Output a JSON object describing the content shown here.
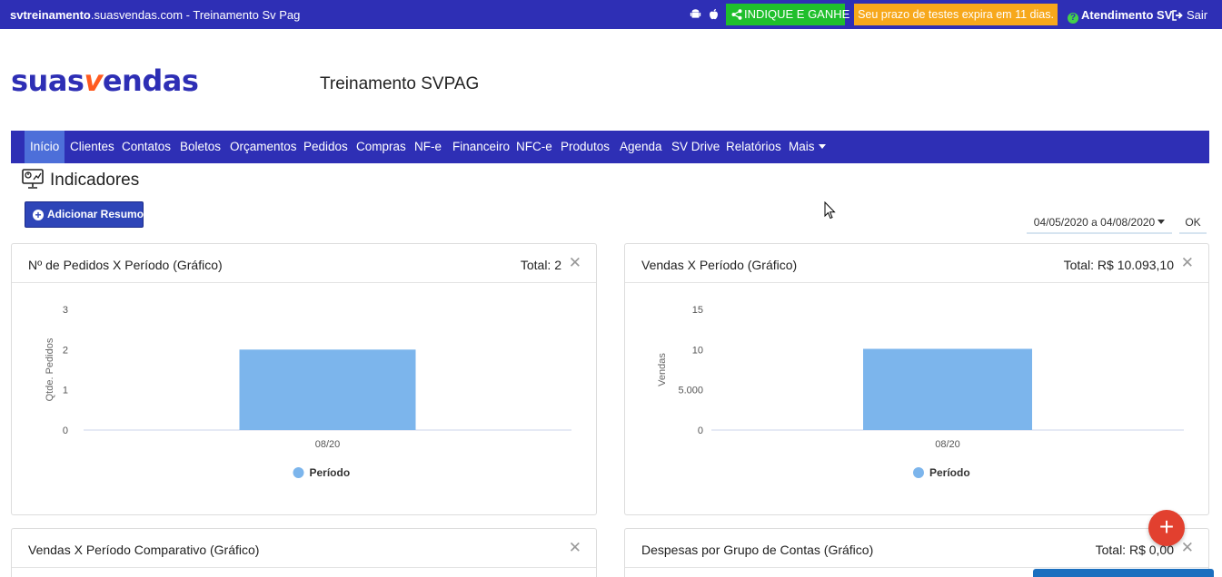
{
  "topbar": {
    "site_bold": "svtreinamento",
    "site_rest": ".suasvendas.com - Treinamento Sv Pag",
    "indique_label": "INDIQUE E GANHE",
    "trial_text": "Seu prazo de testes expira em 11 dias.",
    "atendimento_label": "Atendimento SV",
    "sair_label": "Sair"
  },
  "header": {
    "logo_part1": "suas",
    "logo_accent": "v",
    "logo_part2": "endas",
    "company": "Treinamento SVPAG"
  },
  "nav": {
    "items": [
      {
        "label": "Início"
      },
      {
        "label": "Clientes"
      },
      {
        "label": "Contatos"
      },
      {
        "label": "Boletos"
      },
      {
        "label": "Orçamentos"
      },
      {
        "label": "Pedidos"
      },
      {
        "label": "Compras"
      },
      {
        "label": "NF-e"
      },
      {
        "label": "Financeiro"
      },
      {
        "label": "NFC-e"
      },
      {
        "label": "Produtos"
      },
      {
        "label": "Agenda"
      },
      {
        "label": "SV Drive"
      },
      {
        "label": "Relatórios"
      },
      {
        "label": "Mais"
      }
    ]
  },
  "page": {
    "title": "Indicadores",
    "add_button": "Adicionar Resumo",
    "date_range": "04/05/2020 a 04/08/2020",
    "ok_label": "OK"
  },
  "cards": [
    {
      "title": "Nº de Pedidos X Período (Gráfico)",
      "total": "Total: 2"
    },
    {
      "title": "Vendas X Período (Gráfico)",
      "total": "Total: R$ 10.093,10"
    },
    {
      "title": "Vendas X Período Comparativo (Gráfico)",
      "total": ""
    },
    {
      "title": "Despesas por Grupo de Contas (Gráfico)",
      "total": "Total: R$ 0,00"
    }
  ],
  "close_glyph": "✕",
  "chart_data": [
    {
      "type": "bar",
      "categories": [
        "08/20"
      ],
      "series": [
        {
          "name": "Período",
          "values": [
            2
          ]
        }
      ],
      "ylabel": "Qtde. Pedidos",
      "ylim": [
        0,
        3
      ],
      "yticks": [
        "0",
        "1",
        "2",
        "3"
      ],
      "yticks_values": [
        0,
        1,
        2,
        3
      ],
      "color": "#7cb5ec",
      "legend": "bottom"
    },
    {
      "type": "bar",
      "categories": [
        "08/20"
      ],
      "series": [
        {
          "name": "Período",
          "values": [
            10093.1
          ]
        }
      ],
      "ylabel": "Vendas",
      "ylim": [
        0,
        15000
      ],
      "yticks": [
        "0",
        "5.000",
        "10",
        "15"
      ],
      "yticks_values": [
        0,
        5000,
        10000,
        15000
      ],
      "color": "#7cb5ec",
      "legend": "bottom"
    }
  ],
  "fab_label": "+"
}
